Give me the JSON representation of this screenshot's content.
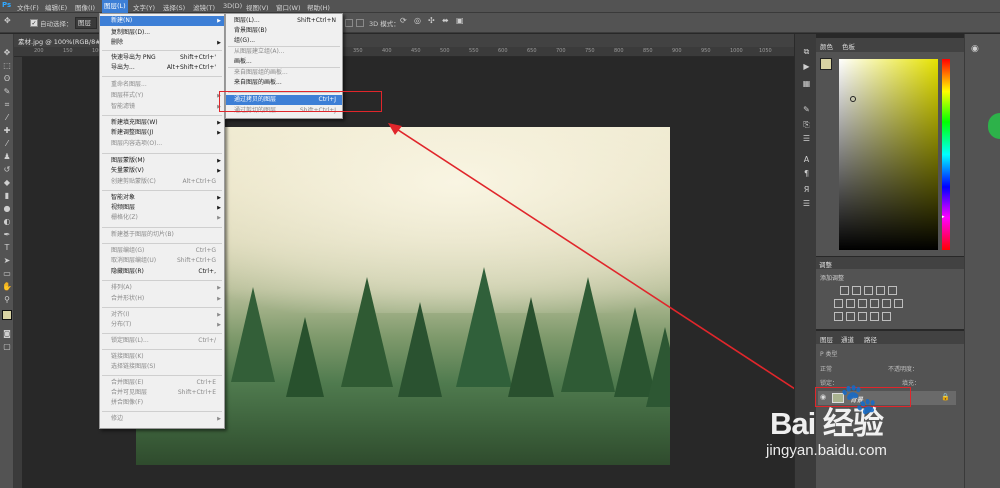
{
  "menubar": {
    "logo": "Ps",
    "items": [
      "文件(F)",
      "编辑(E)",
      "图像(I)",
      "图层(L)",
      "文字(Y)",
      "选择(S)",
      "滤镜(T)",
      "3D(D)",
      "视图(V)",
      "窗口(W)",
      "帮助(H)"
    ]
  },
  "options": {
    "auto_select_label": "自动选择：",
    "auto_select_value": "图层",
    "mode_3d": "3D 模式："
  },
  "document": {
    "tab_title": "素材.jpg @ 100%(RGB/8#)",
    "ruler_ticks": [
      "200",
      "150",
      "100",
      "50",
      "0",
      "50",
      "100",
      "150",
      "200",
      "250",
      "300",
      "350",
      "400",
      "450",
      "500",
      "550",
      "600",
      "650",
      "700",
      "750",
      "800",
      "850",
      "900",
      "950",
      "1000",
      "1050"
    ]
  },
  "layer_menu": {
    "items": [
      {
        "label": "新建(N)",
        "shortcut": "",
        "submenu": true,
        "state": "highlight"
      },
      {
        "label": "复制图层(D)...",
        "shortcut": "",
        "submenu": false,
        "state": "normal"
      },
      {
        "label": "删除",
        "shortcut": "",
        "submenu": true,
        "state": "normal"
      },
      {
        "label": "快速导出为 PNG",
        "shortcut": "Shift+Ctrl+'",
        "submenu": false,
        "state": "normal"
      },
      {
        "label": "导出为...",
        "shortcut": "Alt+Shift+Ctrl+'",
        "submenu": false,
        "state": "normal"
      },
      {
        "label": "重命名图层...",
        "shortcut": "",
        "submenu": false,
        "state": "disabled"
      },
      {
        "label": "图层样式(Y)",
        "shortcut": "",
        "submenu": true,
        "state": "disabled"
      },
      {
        "label": "智能滤镜",
        "shortcut": "",
        "submenu": true,
        "state": "disabled"
      },
      {
        "label": "新建填充图层(W)",
        "shortcut": "",
        "submenu": true,
        "state": "normal"
      },
      {
        "label": "新建调整图层(J)",
        "shortcut": "",
        "submenu": true,
        "state": "normal"
      },
      {
        "label": "图层内容选项(O)...",
        "shortcut": "",
        "submenu": false,
        "state": "disabled"
      },
      {
        "label": "图层蒙版(M)",
        "shortcut": "",
        "submenu": true,
        "state": "normal"
      },
      {
        "label": "矢量蒙版(V)",
        "shortcut": "",
        "submenu": true,
        "state": "normal"
      },
      {
        "label": "创建剪贴蒙版(C)",
        "shortcut": "Alt+Ctrl+G",
        "submenu": false,
        "state": "disabled"
      },
      {
        "label": "智能对象",
        "shortcut": "",
        "submenu": true,
        "state": "normal"
      },
      {
        "label": "视频图层",
        "shortcut": "",
        "submenu": true,
        "state": "normal"
      },
      {
        "label": "栅格化(Z)",
        "shortcut": "",
        "submenu": true,
        "state": "disabled"
      },
      {
        "label": "新建基于图层的切片(B)",
        "shortcut": "",
        "submenu": false,
        "state": "disabled"
      },
      {
        "label": "图层编组(G)",
        "shortcut": "Ctrl+G",
        "submenu": false,
        "state": "disabled"
      },
      {
        "label": "取消图层编组(U)",
        "shortcut": "Shift+Ctrl+G",
        "submenu": false,
        "state": "disabled"
      },
      {
        "label": "隐藏图层(R)",
        "shortcut": "Ctrl+,",
        "submenu": false,
        "state": "normal"
      },
      {
        "label": "排列(A)",
        "shortcut": "",
        "submenu": true,
        "state": "disabled"
      },
      {
        "label": "合并形状(H)",
        "shortcut": "",
        "submenu": true,
        "state": "disabled"
      },
      {
        "label": "对齐(I)",
        "shortcut": "",
        "submenu": true,
        "state": "disabled"
      },
      {
        "label": "分布(T)",
        "shortcut": "",
        "submenu": true,
        "state": "disabled"
      },
      {
        "label": "锁定图层(L)...",
        "shortcut": "Ctrl+/",
        "submenu": false,
        "state": "disabled"
      },
      {
        "label": "链接图层(K)",
        "shortcut": "",
        "submenu": false,
        "state": "disabled"
      },
      {
        "label": "选择链接图层(S)",
        "shortcut": "",
        "submenu": false,
        "state": "disabled"
      },
      {
        "label": "合并图层(E)",
        "shortcut": "Ctrl+E",
        "submenu": false,
        "state": "disabled"
      },
      {
        "label": "合并可见图层",
        "shortcut": "Shift+Ctrl+E",
        "submenu": false,
        "state": "disabled"
      },
      {
        "label": "拼合图像(F)",
        "shortcut": "",
        "submenu": false,
        "state": "disabled"
      },
      {
        "label": "修边",
        "shortcut": "",
        "submenu": true,
        "state": "disabled"
      }
    ]
  },
  "new_submenu": {
    "items": [
      {
        "label": "图层(L)...",
        "shortcut": "Shift+Ctrl+N",
        "state": "normal"
      },
      {
        "label": "背景图层(B)",
        "shortcut": "",
        "state": "normal"
      },
      {
        "label": "组(G)...",
        "shortcut": "",
        "state": "normal"
      },
      {
        "label": "从图层建立组(A)...",
        "shortcut": "",
        "state": "disabled"
      },
      {
        "label": "画板...",
        "shortcut": "",
        "state": "normal"
      },
      {
        "label": "来自图层组的画板...",
        "shortcut": "",
        "state": "disabled"
      },
      {
        "label": "来自图层的画板...",
        "shortcut": "",
        "state": "normal"
      },
      {
        "label": "通过拷贝的图层",
        "shortcut": "Ctrl+J",
        "state": "highlight"
      },
      {
        "label": "通过剪切的图层",
        "shortcut": "Shift+Ctrl+J",
        "state": "disabled"
      }
    ]
  },
  "panels": {
    "color_tab": "颜色",
    "swatches_tab": "色板",
    "adjust_title": "调整",
    "adjust_label": "添加调整",
    "layers_tab": "图层",
    "channels_tab": "通道",
    "paths_tab": "路径",
    "kind_label": "P 类型",
    "blend_mode": "正常",
    "opacity_label": "不透明度：",
    "lock_label": "锁定：",
    "fill_label": "填充：",
    "layer_name": "背景"
  },
  "colors": {
    "accent": "#3d7fd6",
    "highlight_box": "#e0262b",
    "foreground": "#d9d3a3"
  },
  "watermark": {
    "brand": "Bai 经验",
    "url": "jingyan.baidu.com"
  }
}
